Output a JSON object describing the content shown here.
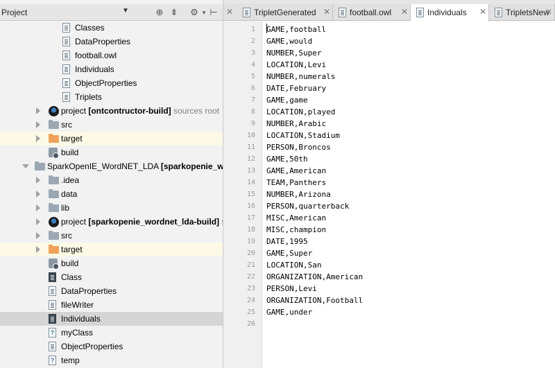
{
  "project_panel": {
    "title": "Project",
    "header_icons": [
      "crosshair-icon",
      "collapse-icon",
      "gear-icon",
      "hide-icon"
    ],
    "tree": [
      {
        "label": "Classes",
        "icon": "file",
        "indent": 90,
        "arrow": "none"
      },
      {
        "label": "DataProperties",
        "icon": "file",
        "indent": 90,
        "arrow": "none"
      },
      {
        "label": "football.owl",
        "icon": "file",
        "indent": 90,
        "arrow": "none"
      },
      {
        "label": "Individuals",
        "icon": "file",
        "indent": 90,
        "arrow": "none"
      },
      {
        "label": "ObjectProperties",
        "icon": "file",
        "indent": 90,
        "arrow": "none"
      },
      {
        "label": "Triplets",
        "icon": "file",
        "indent": 90,
        "arrow": "none"
      },
      {
        "label": "project ",
        "bold": "[ontcontructor-build]",
        "suffix": " sources root",
        "icon": "project",
        "indent": 70,
        "arrow": "right"
      },
      {
        "label": "src",
        "icon": "folder",
        "indent": 70,
        "arrow": "right"
      },
      {
        "label": "target",
        "icon": "folder-orange",
        "indent": 70,
        "arrow": "right",
        "highlight": true
      },
      {
        "label": "build",
        "icon": "build",
        "indent": 70,
        "arrow": "none"
      },
      {
        "label": "SparkOpenIE_WordNET_LDA ",
        "bold": "[sparkopenie_word",
        "suffix": "",
        "icon": "folder",
        "indent": 50,
        "arrow": "down"
      },
      {
        "label": ".idea",
        "icon": "folder",
        "indent": 70,
        "arrow": "right"
      },
      {
        "label": "data",
        "icon": "folder",
        "indent": 70,
        "arrow": "right"
      },
      {
        "label": "lib",
        "icon": "folder",
        "indent": 70,
        "arrow": "right"
      },
      {
        "label": "project ",
        "bold": "[sparkopenie_wordnet_lda-build]",
        "suffix": " s",
        "icon": "project",
        "indent": 70,
        "arrow": "right"
      },
      {
        "label": "src",
        "icon": "folder",
        "indent": 70,
        "arrow": "right"
      },
      {
        "label": "target",
        "icon": "folder-orange",
        "indent": 70,
        "arrow": "right",
        "highlight": true
      },
      {
        "label": "build",
        "icon": "build",
        "indent": 70,
        "arrow": "none"
      },
      {
        "label": "Class",
        "icon": "file-dark",
        "indent": 70,
        "arrow": "none"
      },
      {
        "label": "DataProperties",
        "icon": "file",
        "indent": 70,
        "arrow": "none"
      },
      {
        "label": "fileWriter",
        "icon": "file",
        "indent": 70,
        "arrow": "none"
      },
      {
        "label": "Individuals",
        "icon": "file-dark",
        "indent": 70,
        "arrow": "none",
        "selected": true
      },
      {
        "label": "myClass",
        "icon": "q",
        "indent": 70,
        "arrow": "none"
      },
      {
        "label": "ObjectProperties",
        "icon": "file",
        "indent": 70,
        "arrow": "none"
      },
      {
        "label": "temp",
        "icon": "q",
        "indent": 70,
        "arrow": "none"
      }
    ]
  },
  "tabs": [
    {
      "label": "TripletGenerated",
      "active": false
    },
    {
      "label": "football.owl",
      "active": false
    },
    {
      "label": "Individuals",
      "active": true
    },
    {
      "label": "TripletsNew",
      "active": false
    }
  ],
  "editor": {
    "lines": [
      "GAME,football",
      "GAME,would",
      "NUMBER,Super",
      "LOCATION,Levi",
      "NUMBER,numerals",
      "DATE,February",
      "GAME,game",
      "LOCATION,played",
      "NUMBER,Arabic",
      "LOCATION,Stadium",
      "PERSON,Broncos",
      "GAME,50th",
      "GAME,American",
      "TEAM,Panthers",
      "NUMBER,Arizona",
      "PERSON,quarterback",
      "MISC,American",
      "MISC,champion",
      "DATE,1995",
      "GAME,Super",
      "LOCATION,San",
      "ORGANIZATION,American",
      "PERSON,Levi",
      "ORGANIZATION,Football",
      "GAME,under",
      ""
    ]
  }
}
